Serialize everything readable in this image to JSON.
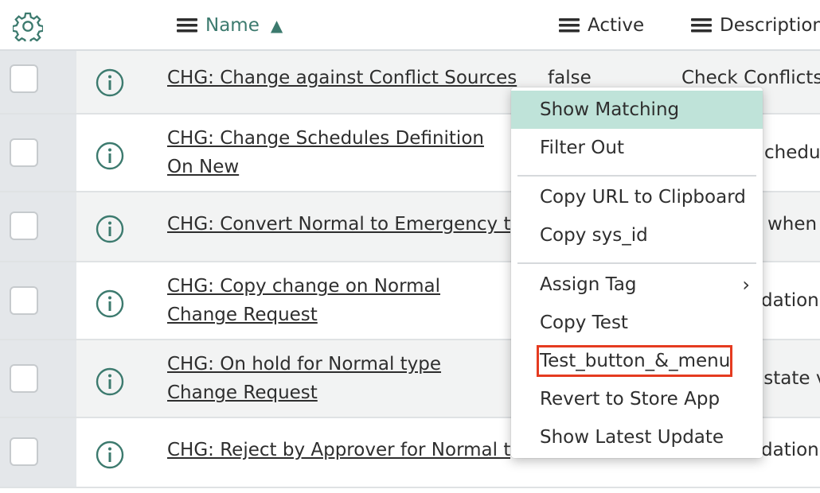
{
  "header": {
    "settings_icon": "gear-icon",
    "columns": [
      {
        "label": "Name",
        "sort": "ascending"
      },
      {
        "label": "Active"
      },
      {
        "label": "Description"
      }
    ],
    "sort_indicator": "▲"
  },
  "rows": [
    {
      "name": "CHG: Change against Conflict Sources",
      "active": "false",
      "description": "Check Conflicts a"
    },
    {
      "name": "CHG: Change Schedules Definition On New",
      "active": "",
      "description": "chedu"
    },
    {
      "name": "CHG: Convert Normal to Emergency type",
      "active": "",
      "description": "when"
    },
    {
      "name": "CHG: Copy change on Normal Change Request",
      "active": "",
      "description": "dation"
    },
    {
      "name": "CHG: On hold for Normal type Change Request",
      "active": "",
      "description": "s state v"
    },
    {
      "name": "CHG: Reject by Approver for Normal type",
      "active": "",
      "description": "dation"
    }
  ],
  "context_menu": {
    "items": [
      {
        "label": "Show Matching"
      },
      {
        "label": "Filter Out"
      },
      {
        "label": "Copy URL to Clipboard"
      },
      {
        "label": "Copy sys_id"
      },
      {
        "label": "Assign Tag",
        "submenu": "chevron-right-icon"
      },
      {
        "label": "Copy Test"
      },
      {
        "label": "Test_button_&_menu"
      },
      {
        "label": "Revert to Store App"
      },
      {
        "label": "Show Latest Update"
      }
    ]
  },
  "colors": {
    "accent": "#3c7a6e",
    "highlight": "#bfe3d9",
    "annotation": "#e53b20",
    "gutter": "#e4e7ea"
  }
}
